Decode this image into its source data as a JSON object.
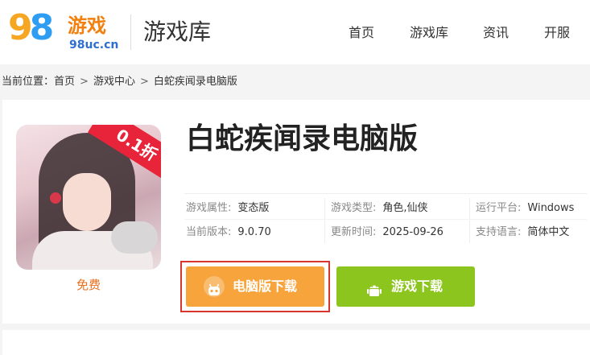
{
  "header": {
    "logo": {
      "digits": "98",
      "brand": "游戏",
      "domain": "98uc.cn"
    },
    "site_title": "游戏库",
    "nav": [
      "首页",
      "游戏库",
      "资讯",
      "开服"
    ]
  },
  "breadcrumb": {
    "prefix": "当前位置：",
    "items": [
      "首页",
      "游戏中心",
      "白蛇疾闻录电脑版"
    ],
    "separator": ">"
  },
  "game": {
    "title": "白蛇疾闻录电脑版",
    "cover_badge": "0.1折",
    "price_label": "免费",
    "info": [
      {
        "label": "游戏属性:",
        "value": "变态版"
      },
      {
        "label": "游戏类型:",
        "value": "角色,仙侠"
      },
      {
        "label": "运行平台:",
        "value": "Windows"
      },
      {
        "label": "当前版本:",
        "value": "9.0.70"
      },
      {
        "label": "更新时间:",
        "value": "2025-09-26"
      },
      {
        "label": "支持语言:",
        "value": "简体中文"
      }
    ]
  },
  "buttons": {
    "pc_download": "电脑版下载",
    "game_download": "游戏下载"
  },
  "colors": {
    "logo_orange": "#f5a623",
    "logo_blue": "#2e9df2",
    "pc_button": "#f7a43c",
    "game_button": "#8cc51e",
    "highlight_border": "#d9362e",
    "free_text": "#e8701f"
  },
  "icons": {
    "pc_button_icon": "gamepad-robot-icon",
    "game_button_icon": "android-icon"
  }
}
